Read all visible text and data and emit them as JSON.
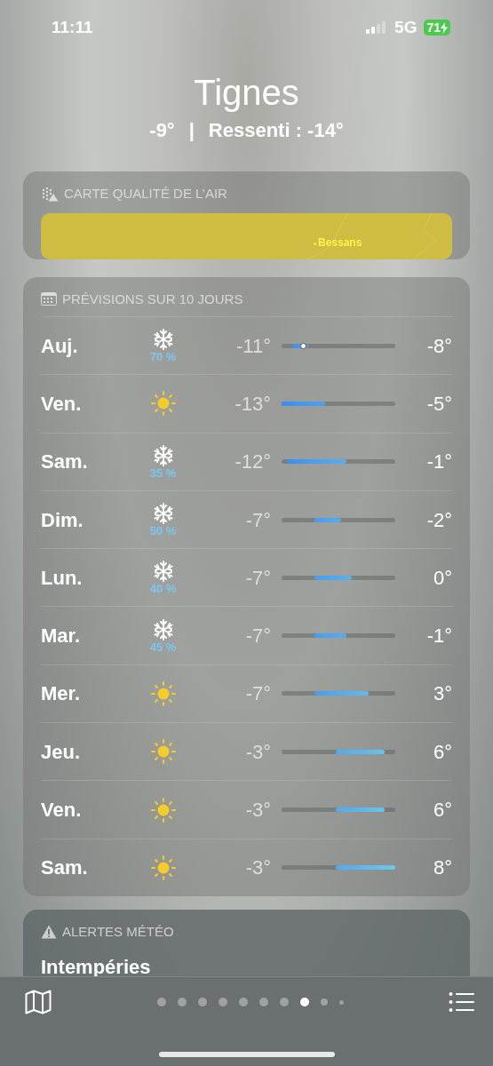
{
  "status_bar": {
    "time": "11:11",
    "network": "5G",
    "battery": "71",
    "charging": true
  },
  "location": {
    "city": "Tignes",
    "current": "-9°",
    "separator": "|",
    "feels_like": "Ressenti : -14°"
  },
  "air_quality": {
    "title": "CARTE QUALITÉ DE L’AIR",
    "map_label": "Bessans"
  },
  "forecast": {
    "title": "PRÉVISIONS SUR 10 JOURS",
    "days": [
      {
        "day": "Auj.",
        "kind": "snow",
        "chance": "70 %",
        "low": "-11°",
        "high": "-8°",
        "today": true
      },
      {
        "day": "Ven.",
        "kind": "sun",
        "low": "-13°",
        "high": "-5°",
        "today": false
      },
      {
        "day": "Sam.",
        "kind": "snow",
        "chance": "35 %",
        "low": "-12°",
        "high": "-1°",
        "today": false
      },
      {
        "day": "Dim.",
        "kind": "snow",
        "chance": "50 %",
        "low": "-7°",
        "high": "-2°",
        "today": false
      },
      {
        "day": "Lun.",
        "kind": "snow",
        "chance": "40 %",
        "low": "-7°",
        "high": "0°",
        "today": false
      },
      {
        "day": "Mar.",
        "kind": "snow",
        "chance": "45 %",
        "low": "-7°",
        "high": "-1°",
        "today": false
      },
      {
        "day": "Mer.",
        "kind": "sun",
        "low": "-7°",
        "high": "3°",
        "today": false
      },
      {
        "day": "Jeu.",
        "kind": "sun",
        "low": "-3°",
        "high": "6°",
        "today": false
      },
      {
        "day": "Ven.",
        "kind": "sun",
        "low": "-3°",
        "high": "6°",
        "today": false
      },
      {
        "day": "Sam.",
        "kind": "sun",
        "low": "-3°",
        "high": "8°",
        "today": false
      }
    ]
  },
  "alerts": {
    "title": "ALERTES MÉTÉO",
    "headline": "Intempéries"
  },
  "page_dots": [
    {
      "selected": false,
      "kind": "normal"
    },
    {
      "selected": false,
      "kind": "normal"
    },
    {
      "selected": false,
      "kind": "normal"
    },
    {
      "selected": false,
      "kind": "normal"
    },
    {
      "selected": false,
      "kind": "normal"
    },
    {
      "selected": false,
      "kind": "normal"
    },
    {
      "selected": false,
      "kind": "normal"
    },
    {
      "selected": true,
      "kind": "normal"
    },
    {
      "selected": false,
      "kind": "small"
    },
    {
      "selected": false,
      "kind": "tiny"
    }
  ]
}
